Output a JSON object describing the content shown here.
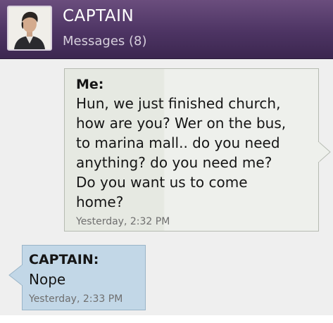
{
  "header": {
    "contact_name": "CAPTAIN",
    "subtitle": "Messages (8)",
    "avatar_icon": "contact-avatar-photo"
  },
  "colors": {
    "header_top": "#6a4d7d",
    "header_bottom": "#3c2750",
    "outgoing_bubble": "#eef0ec",
    "incoming_bubble": "#c2d7e7",
    "timestamp": "#6f6f6f"
  },
  "messages": [
    {
      "direction": "outgoing",
      "sender": "Me:",
      "lines": [
        "Hun, we just finished church,",
        "how are you? Wer on the bus,",
        "to marina mall.. do you need",
        "anything? do you need me?",
        "Do you want us to come",
        "home?"
      ],
      "timestamp": "Yesterday, 2:32 PM"
    },
    {
      "direction": "incoming",
      "sender": "CAPTAIN:",
      "lines": [
        "Nope"
      ],
      "timestamp": "Yesterday, 2:33 PM"
    }
  ]
}
